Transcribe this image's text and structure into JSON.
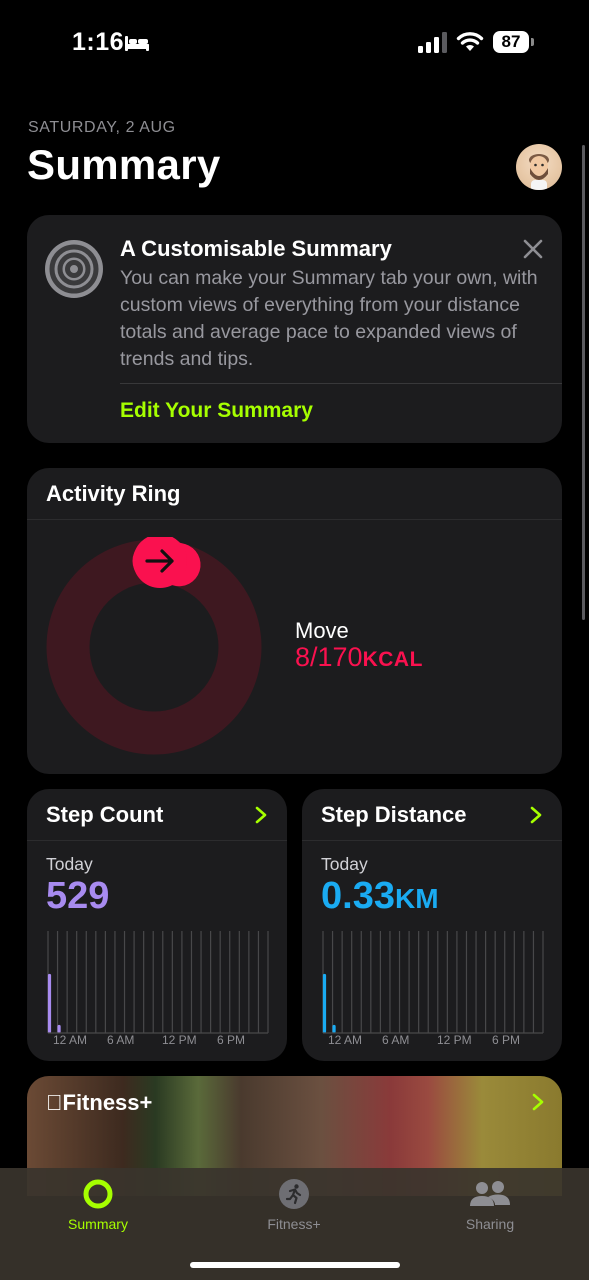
{
  "status_bar": {
    "time": "1:16",
    "battery": "87",
    "icons": [
      "bed-icon",
      "cellular-signal-icon",
      "wifi-icon",
      "battery-icon"
    ]
  },
  "header": {
    "date": "SATURDAY, 2 AUG",
    "title": "Summary",
    "avatar": "memoji-avatar"
  },
  "info_card": {
    "title": "A Customisable Summary",
    "body": "You can make your Summary tab your own, with custom views of everything from your distance totals and average pace to expanded views of trends and tips.",
    "link": "Edit Your Summary",
    "icon": "activity-rings-icon"
  },
  "activity_ring": {
    "title": "Activity Ring",
    "move_label": "Move",
    "move_value": "8/170",
    "move_unit": "KCAL",
    "move_current": 8,
    "move_goal": 170
  },
  "step_count": {
    "title": "Step Count",
    "period": "Today",
    "value": "529",
    "axis_labels": [
      "12 AM",
      "6 AM",
      "12 PM",
      "6 PM"
    ],
    "hourly_fraction": [
      0.58,
      0.08
    ]
  },
  "step_distance": {
    "title": "Step Distance",
    "period": "Today",
    "value": "0.33",
    "unit": "KM",
    "axis_labels": [
      "12 AM",
      "6 AM",
      "12 PM",
      "6 PM"
    ],
    "hourly_fraction": [
      0.58,
      0.08
    ]
  },
  "fitness_plus": {
    "title": "Fitness+"
  },
  "tab_bar": {
    "tabs": [
      {
        "label": "Summary",
        "icon": "activity-ring-icon",
        "active": true
      },
      {
        "label": "Fitness+",
        "icon": "runner-icon",
        "active": false
      },
      {
        "label": "Sharing",
        "icon": "people-icon",
        "active": false
      }
    ]
  },
  "colors": {
    "accent": "#a6ff00",
    "move": "#fa114f",
    "steps": "#a88bf0",
    "distance": "#1aabf2",
    "card": "#1c1c1e"
  }
}
